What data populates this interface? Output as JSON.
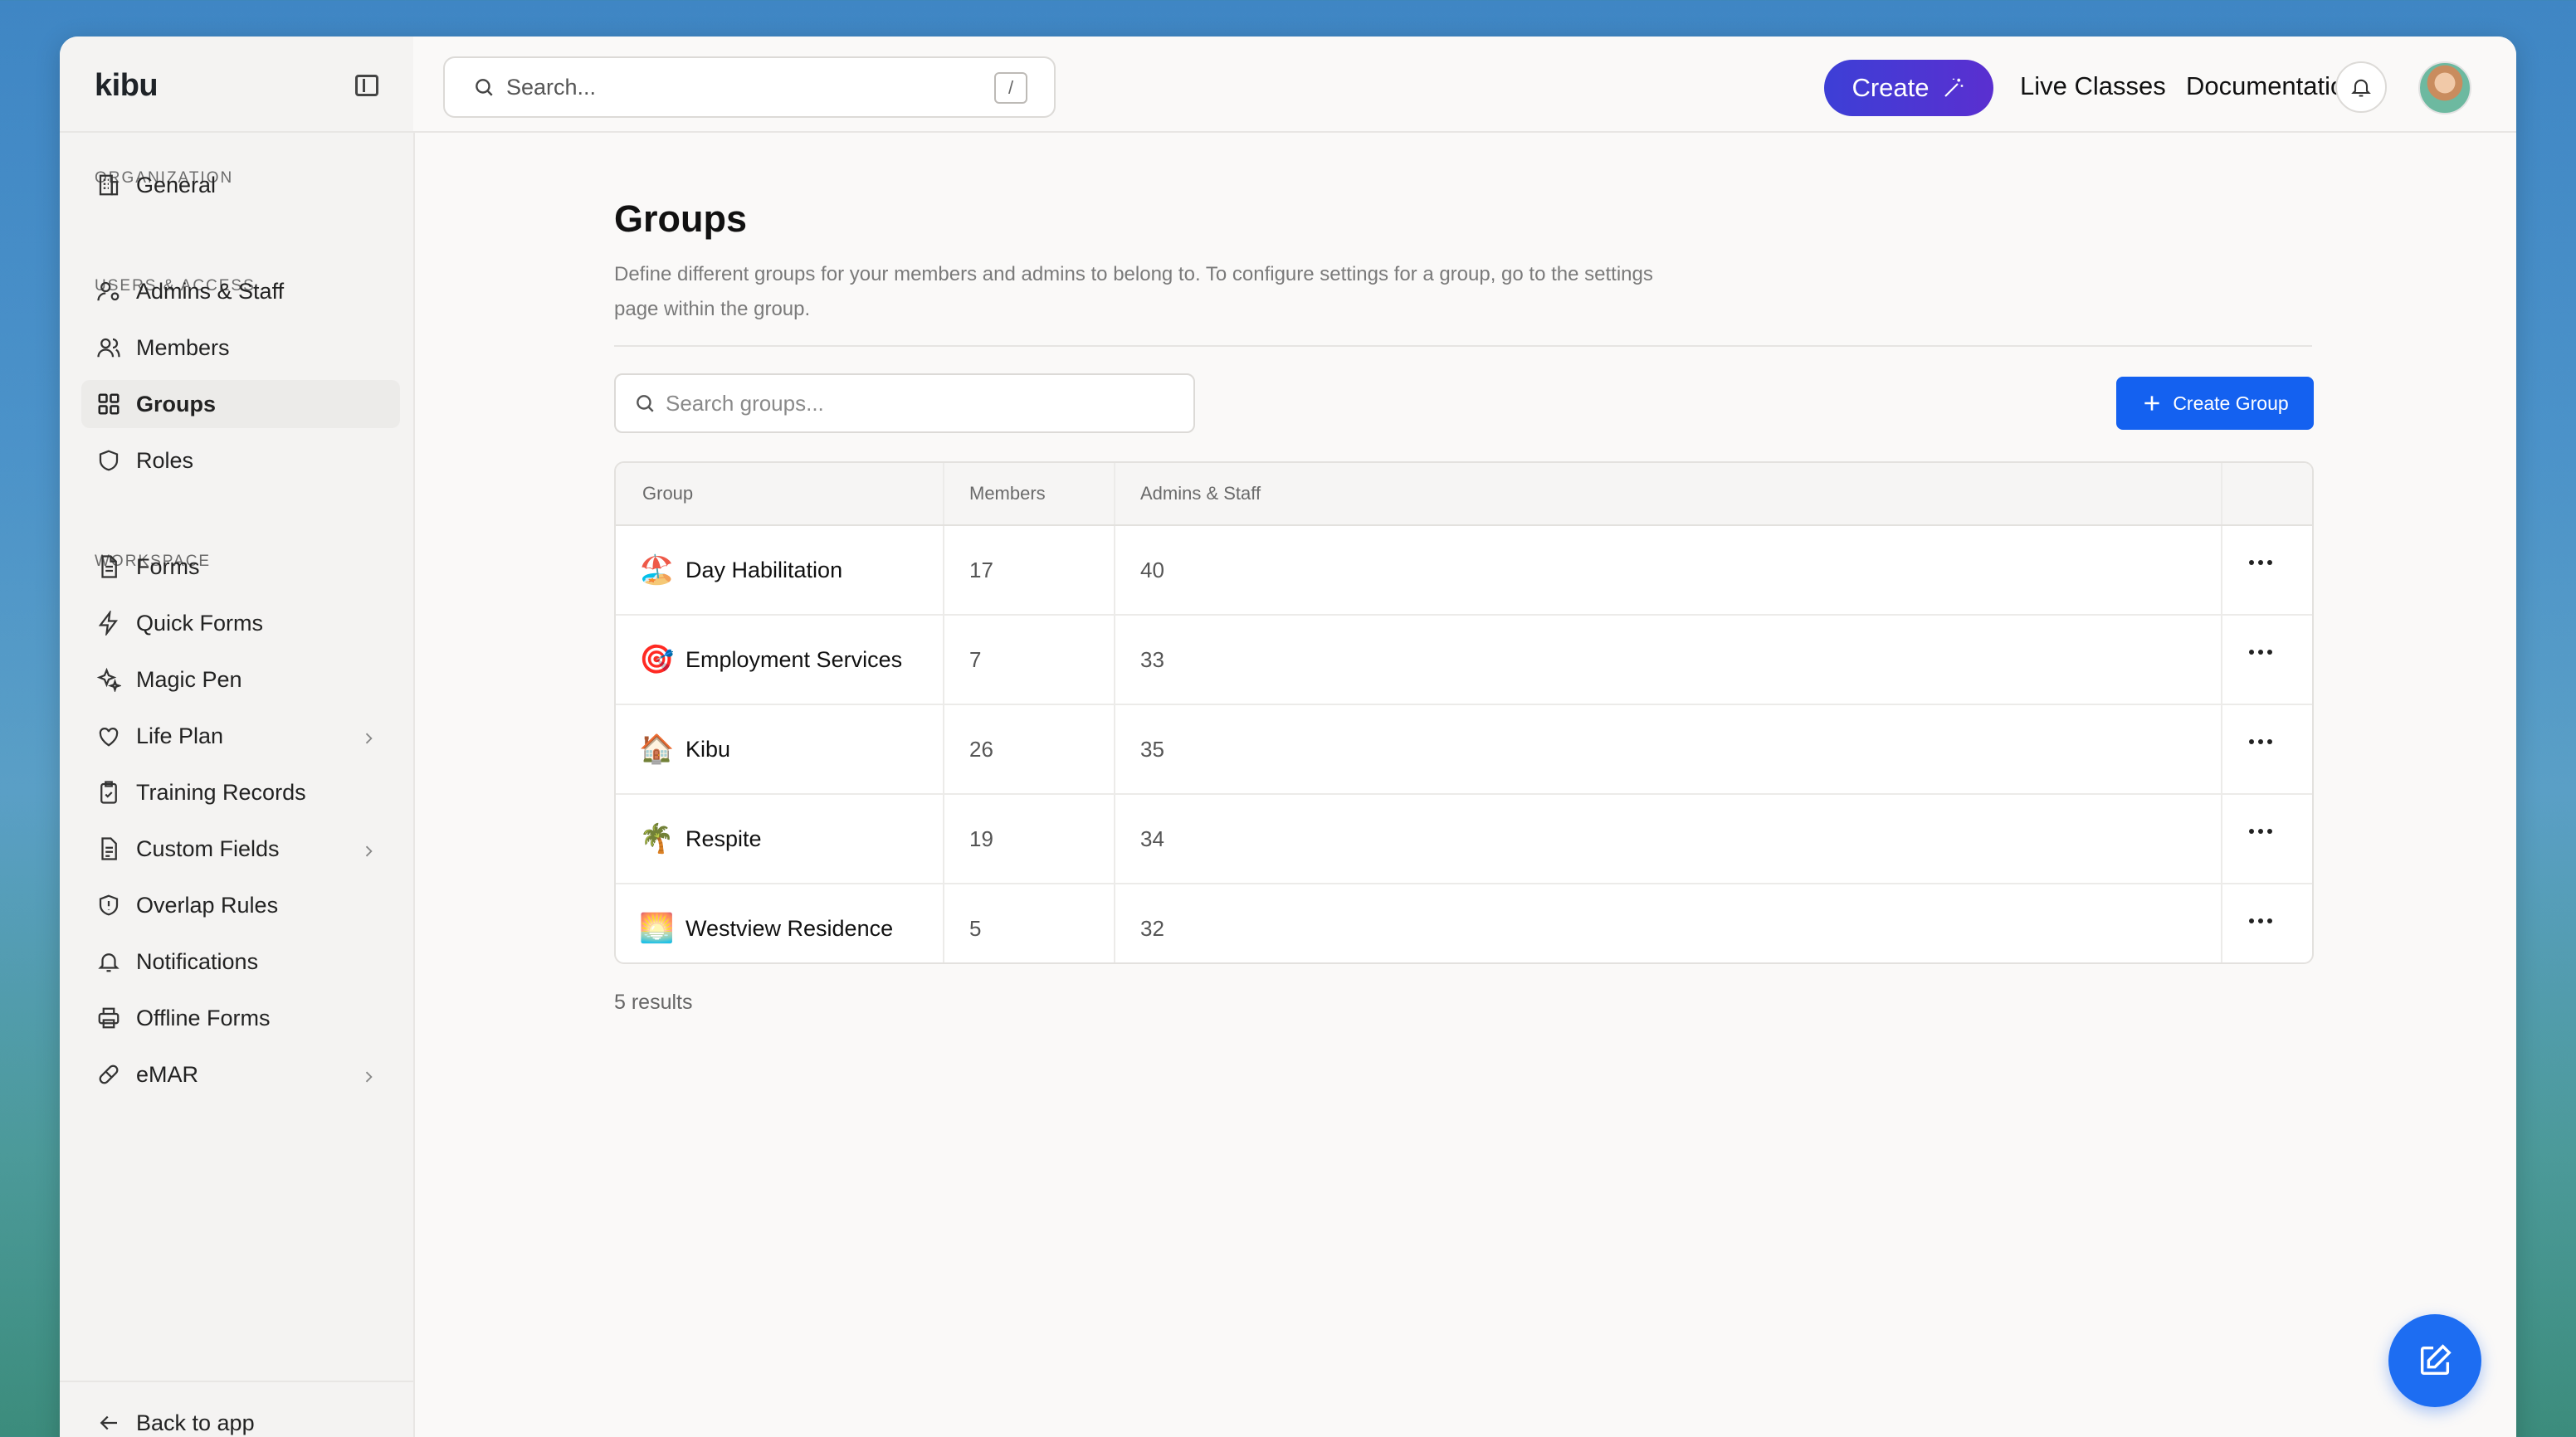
{
  "app": {
    "brand": "kibu"
  },
  "topbar": {
    "search_placeholder": "Search...",
    "search_shortcut": "/",
    "create_label": "Create",
    "links": [
      "Live Classes",
      "Documentation"
    ]
  },
  "sidebar": {
    "sections": {
      "organization": "ORGANIZATION",
      "users_access": "USERS & ACCESS",
      "workspace": "WORKSPACE"
    },
    "items": {
      "general": "General",
      "admins_staff": "Admins & Staff",
      "members": "Members",
      "groups": "Groups",
      "roles": "Roles",
      "forms": "Forms",
      "quick_forms": "Quick Forms",
      "magic_pen": "Magic Pen",
      "life_plan": "Life Plan",
      "training_records": "Training Records",
      "custom_fields": "Custom Fields",
      "overlap_rules": "Overlap Rules",
      "notifications": "Notifications",
      "offline_forms": "Offline Forms",
      "emar": "eMAR"
    },
    "active": "groups",
    "back_label": "Back to app"
  },
  "page": {
    "title": "Groups",
    "description": "Define different groups for your members and admins to belong to. To configure settings for a group, go to the settings page within the group.",
    "search_placeholder": "Search groups...",
    "create_button": "Create Group",
    "results_text": "5 results"
  },
  "table": {
    "columns": [
      "Group",
      "Members",
      "Admins & Staff"
    ],
    "rows": [
      {
        "emoji": "🏖️",
        "name": "Day Habilitation",
        "members": "17",
        "admins": "40"
      },
      {
        "emoji": "🎯",
        "name": "Employment Services",
        "members": "7",
        "admins": "33"
      },
      {
        "emoji": "🏠",
        "name": "Kibu",
        "members": "26",
        "admins": "35"
      },
      {
        "emoji": "🌴",
        "name": "Respite",
        "members": "19",
        "admins": "34"
      },
      {
        "emoji": "🌅",
        "name": "Westview Residence",
        "members": "5",
        "admins": "32"
      }
    ]
  },
  "colors": {
    "primary": "#1461f0",
    "create_gradient_start": "#3d3fd6",
    "create_gradient_end": "#5a2fd0"
  }
}
